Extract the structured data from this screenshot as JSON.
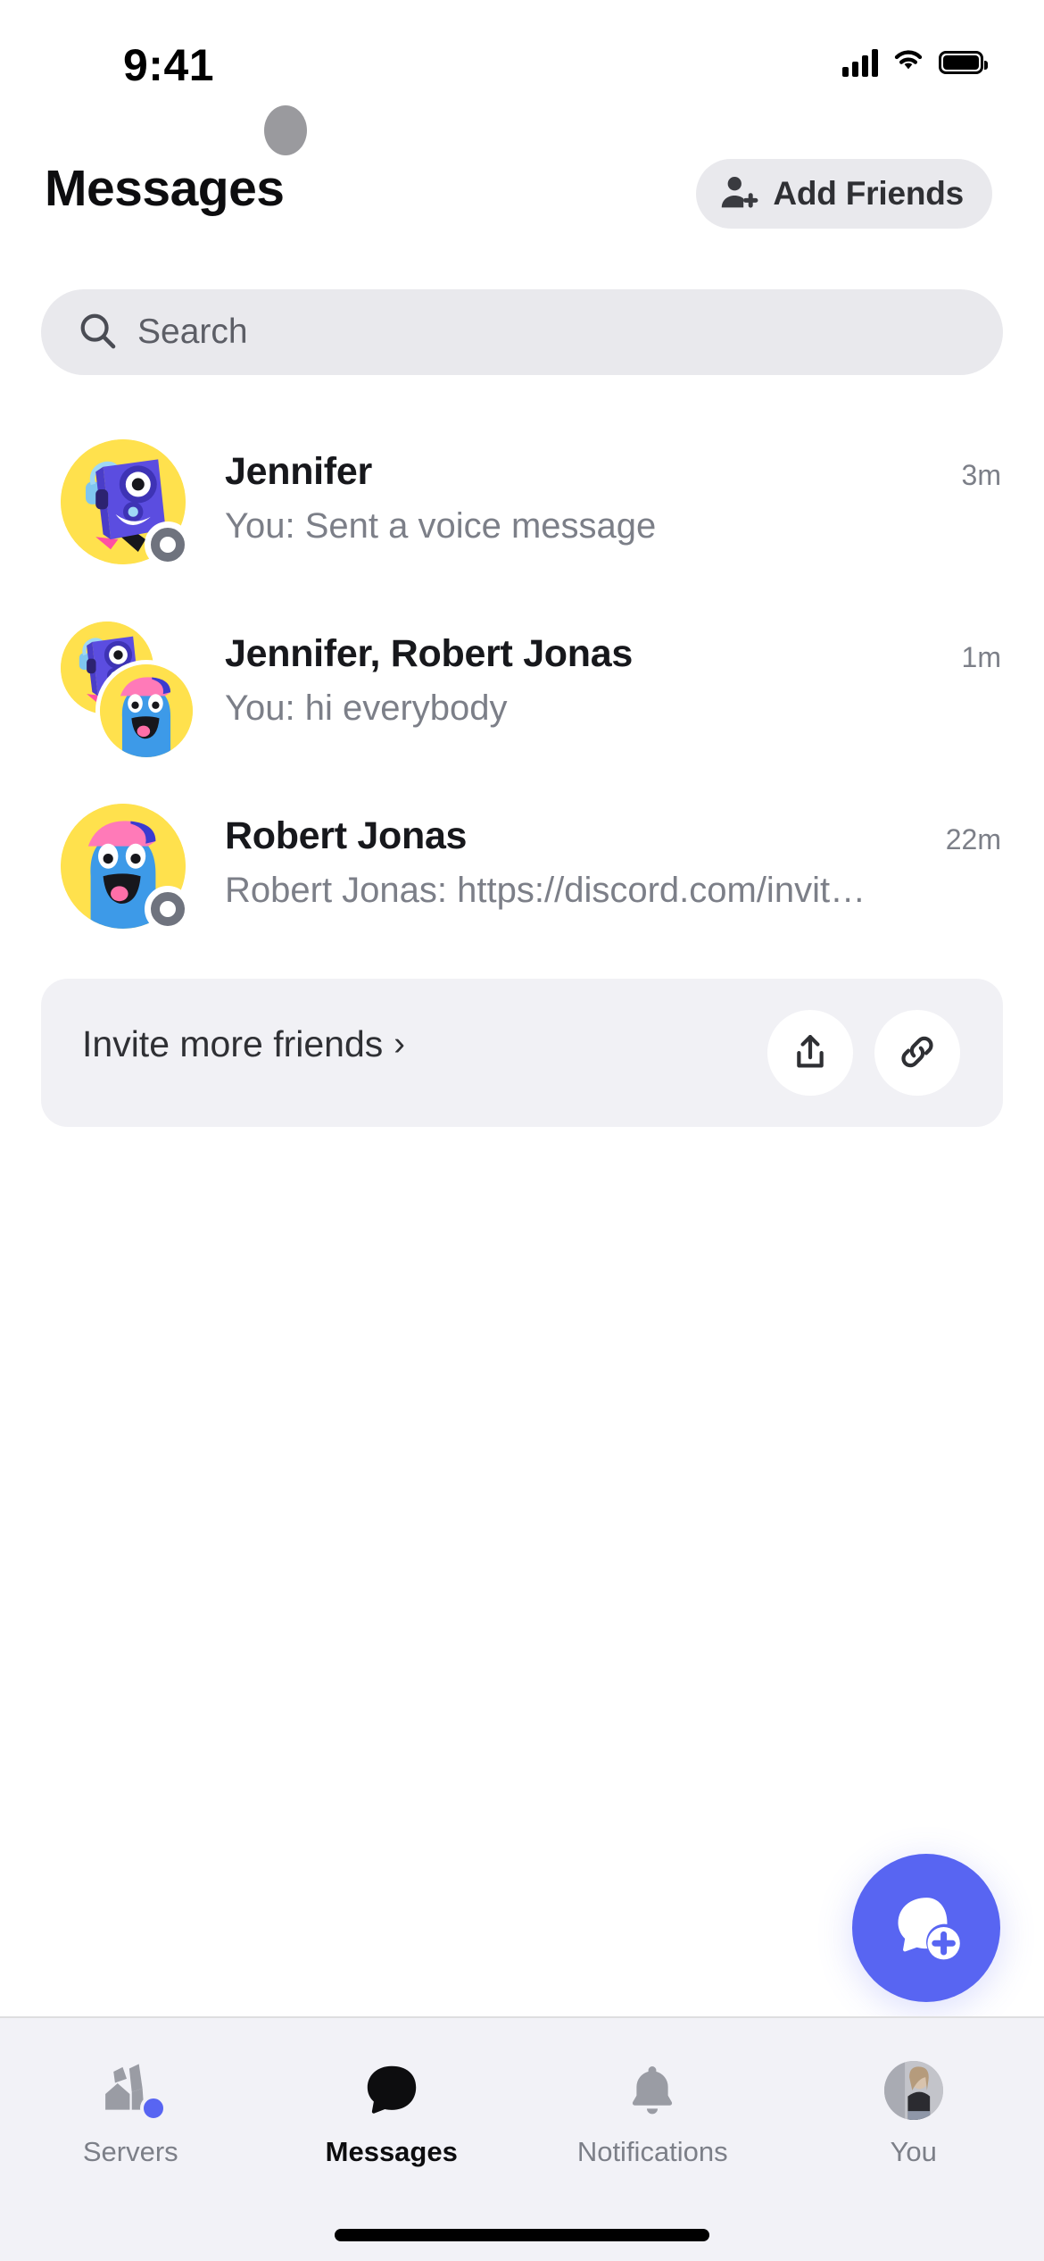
{
  "status_bar": {
    "time": "9:41",
    "cellular_icon": "signal-bars-icon",
    "wifi_icon": "wifi-icon",
    "battery_icon": "battery-full-icon"
  },
  "header": {
    "title": "Messages",
    "add_friends": {
      "label": "Add Friends",
      "icon": "person-plus-icon"
    }
  },
  "search": {
    "placeholder": "Search",
    "value": "",
    "icon": "search-icon"
  },
  "conversations": [
    {
      "name": "Jennifer",
      "preview": "You: Sent a voice message",
      "time": "3m",
      "type": "dm",
      "status": "offline",
      "avatar_kind": "robot-box-avatar"
    },
    {
      "name": "Jennifer, Robert Jonas",
      "preview": "You: hi everybody",
      "time": "1m",
      "type": "group",
      "status": "none",
      "avatar_kind": "group-avatar"
    },
    {
      "name": "Robert Jonas",
      "preview": "Robert Jonas: https://discord.com/invite/...",
      "time": "22m",
      "type": "dm",
      "status": "offline",
      "avatar_kind": "blue-cap-avatar"
    }
  ],
  "invite_card": {
    "label": "Invite more friends",
    "chevron": "›",
    "share_icon": "share-icon",
    "link_icon": "link-icon"
  },
  "fab": {
    "icon": "new-message-icon",
    "color": "#5865f2"
  },
  "tabbar": {
    "items": [
      {
        "label": "Servers",
        "icon": "servers-icon",
        "active": false,
        "badge": true
      },
      {
        "label": "Messages",
        "icon": "messages-icon",
        "active": true,
        "badge": false
      },
      {
        "label": "Notifications",
        "icon": "bell-icon",
        "active": false,
        "badge": false
      },
      {
        "label": "You",
        "icon": "user-avatar-icon",
        "active": false,
        "badge": false
      }
    ]
  },
  "colors": {
    "accent": "#5865f2",
    "chip_bg": "#e9e9ed",
    "card_bg": "#f1f1f5",
    "tabbar_bg": "#f2f2f7",
    "muted_text": "#7c7f88",
    "primary_text": "#17181c",
    "avatar_yellow": "#ffe14d",
    "offline_gray": "#6f737e"
  }
}
